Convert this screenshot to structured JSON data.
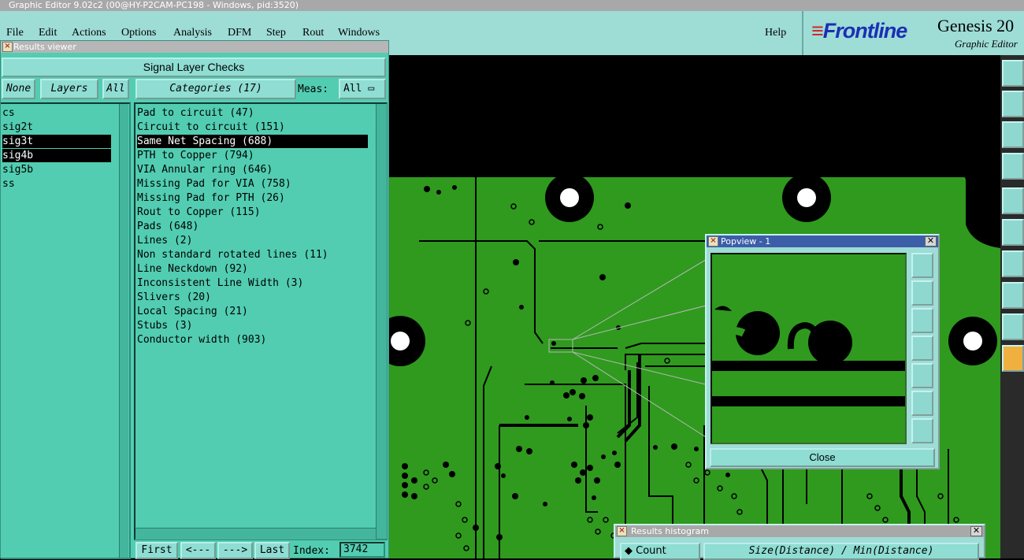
{
  "window": {
    "title": "Graphic Editor 9.02c2 (00@HY-P2CAM-PC198 - Windows, pid:3520)"
  },
  "menu": {
    "items": [
      "File",
      "Edit",
      "Actions",
      "Options",
      "Analysis",
      "DFM",
      "Step",
      "Rout",
      "Windows"
    ],
    "help": "Help"
  },
  "branding": {
    "logo": "Frontline",
    "product": "Genesis 20",
    "subtitle": "Graphic Editor"
  },
  "results_viewer": {
    "title": "Results viewer",
    "header": "Signal Layer Checks",
    "none_label": "None",
    "layers_label": "Layers",
    "all_label": "All",
    "categories_label": "Categories (17)",
    "meas_label": "Meas:",
    "meas_value": "All",
    "layers": [
      {
        "name": "cs",
        "selected": false
      },
      {
        "name": "sig2t",
        "selected": false
      },
      {
        "name": "sig3t",
        "selected": true
      },
      {
        "name": "sig4b",
        "selected": true
      },
      {
        "name": "sig5b",
        "selected": false
      },
      {
        "name": "ss",
        "selected": false
      }
    ],
    "categories": [
      {
        "name": "Pad to circuit (47)",
        "selected": false
      },
      {
        "name": "Circuit to circuit (151)",
        "selected": false
      },
      {
        "name": "Same Net Spacing (688)",
        "selected": true
      },
      {
        "name": "PTH to Copper (794)",
        "selected": false
      },
      {
        "name": "VIA Annular ring (646)",
        "selected": false
      },
      {
        "name": "Missing Pad for VIA (758)",
        "selected": false
      },
      {
        "name": "Missing Pad for PTH (26)",
        "selected": false
      },
      {
        "name": "Rout to Copper (115)",
        "selected": false
      },
      {
        "name": "Pads (648)",
        "selected": false
      },
      {
        "name": "Lines (2)",
        "selected": false
      },
      {
        "name": "Non standard rotated lines (11)",
        "selected": false
      },
      {
        "name": "Line Neckdown (92)",
        "selected": false
      },
      {
        "name": "Inconsistent Line Width (3)",
        "selected": false
      },
      {
        "name": "Slivers (20)",
        "selected": false
      },
      {
        "name": "Local Spacing (21)",
        "selected": false
      },
      {
        "name": "Stubs (3)",
        "selected": false
      },
      {
        "name": "Conductor width (903)",
        "selected": false
      }
    ],
    "nav": {
      "first": "First",
      "prev": "<---",
      "next": "--->",
      "last": "Last",
      "index_label": "Index:",
      "index_value": "3742"
    }
  },
  "popview": {
    "title": "Popview - 1",
    "close_label": "Close"
  },
  "histogram": {
    "title": "Results histogram",
    "count_label": "Count",
    "axis_label": "Size(Distance) / Min(Distance)"
  },
  "colors": {
    "board": "#2f9a1e",
    "panel": "#52cdb1",
    "chrome": "#9edcd6",
    "selection": "#000000"
  }
}
